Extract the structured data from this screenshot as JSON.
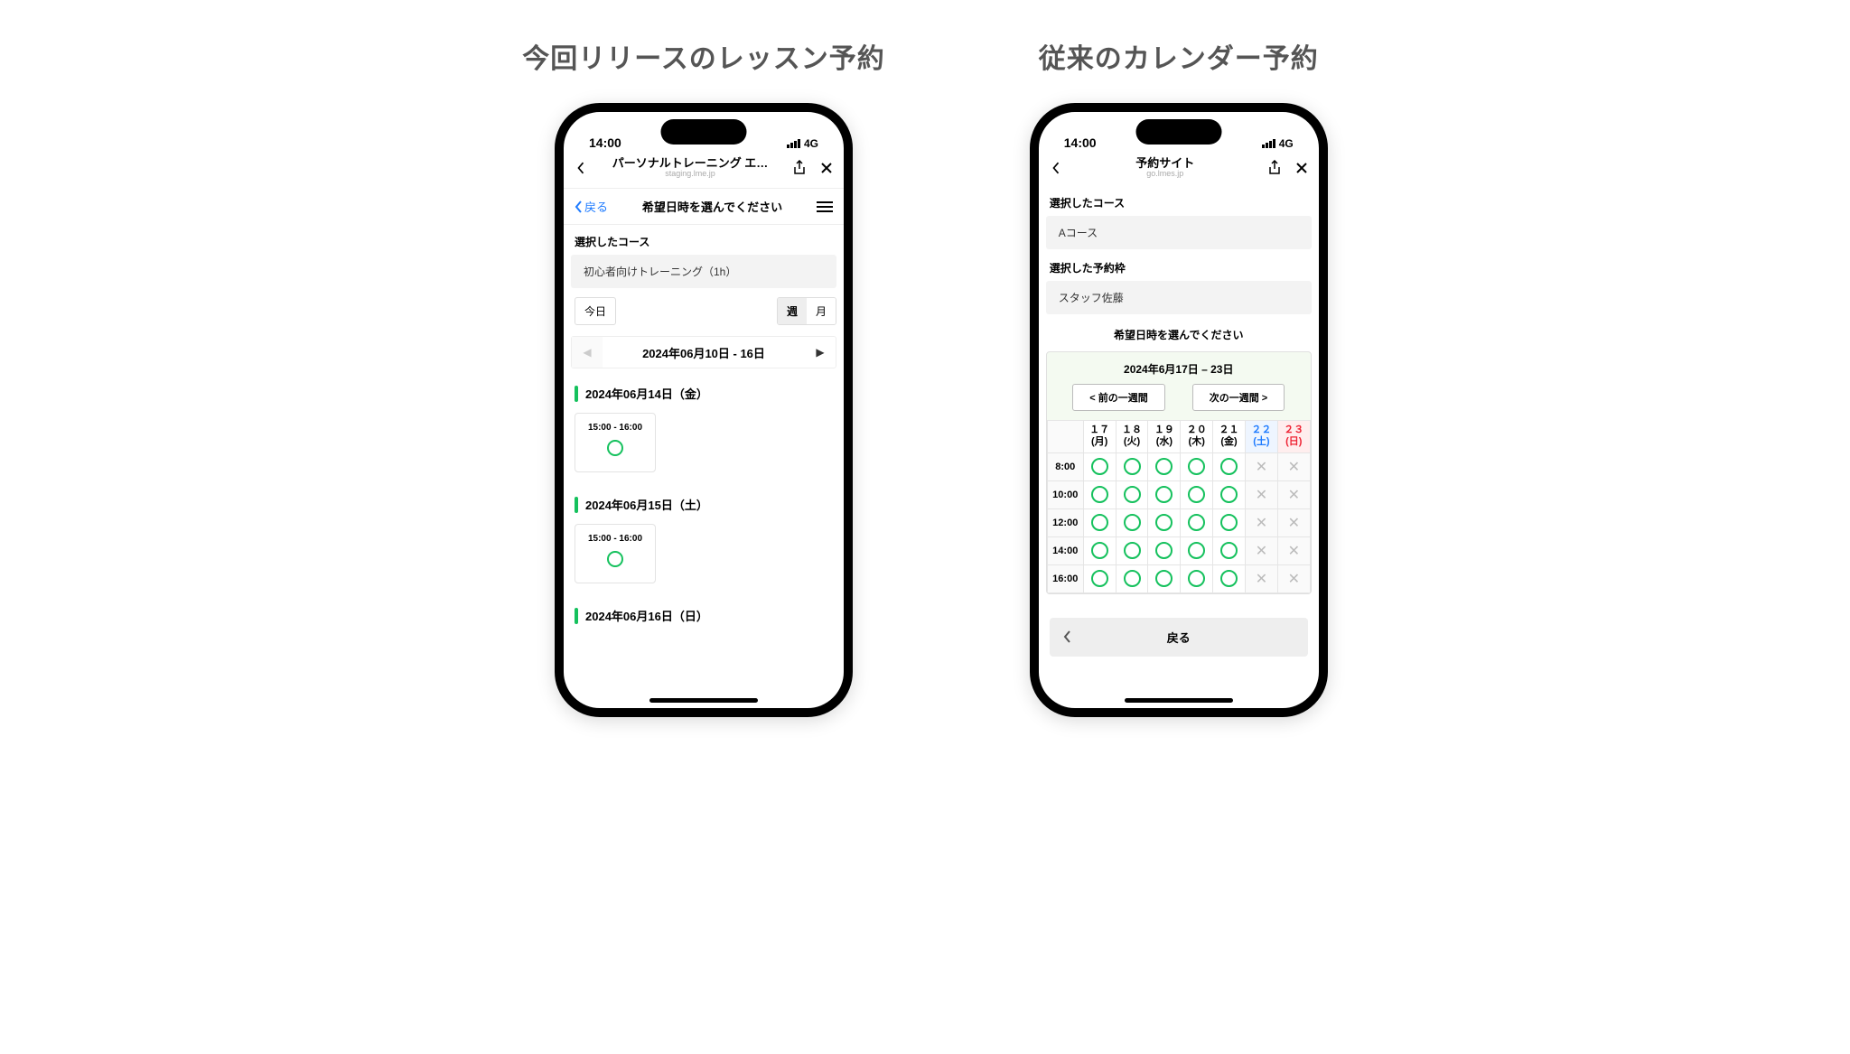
{
  "captions": {
    "left": "今回リリースのレッスン予約",
    "right": "従来のカレンダー予約"
  },
  "status": {
    "time": "14:00",
    "network": "4G"
  },
  "left": {
    "header": {
      "title": "パーソナルトレーニング エ…",
      "domain": "staging.lme.jp"
    },
    "toolbar": {
      "back": "戻る",
      "title": "希望日時を選んでください"
    },
    "section_label": "選択したコース",
    "course": "初心者向けトレーニング（1h）",
    "today": "今日",
    "seg": {
      "week": "週",
      "month": "月"
    },
    "range": "2024年06月10日 - 16日",
    "days": [
      {
        "label": "2024年06月14日（金）",
        "slot": "15:00 - 16:00"
      },
      {
        "label": "2024年06月15日（土）",
        "slot": "15:00 - 16:00"
      },
      {
        "label": "2024年06月16日（日）"
      }
    ]
  },
  "right": {
    "header": {
      "title": "予約サイト",
      "domain": "go.lmes.jp"
    },
    "sec1": "選択したコース",
    "course": "Aコース",
    "sec2": "選択した予約枠",
    "staff": "スタッフ佐藤",
    "prompt": "希望日時を選んでください",
    "range": "2024年6月17日 – 23日",
    "prev": "< 前の一週間",
    "next": "次の一週間 >",
    "day_cols": [
      {
        "num": "１７",
        "dow": "(月)",
        "cls": ""
      },
      {
        "num": "１８",
        "dow": "(火)",
        "cls": ""
      },
      {
        "num": "１９",
        "dow": "(水)",
        "cls": ""
      },
      {
        "num": "２０",
        "dow": "(木)",
        "cls": ""
      },
      {
        "num": "２１",
        "dow": "(金)",
        "cls": ""
      },
      {
        "num": "２２",
        "dow": "(土)",
        "cls": "sat"
      },
      {
        "num": "２３",
        "dow": "(日)",
        "cls": "sun"
      }
    ],
    "rows": [
      {
        "t": "8:00",
        "cells": [
          "o",
          "o",
          "o",
          "o",
          "o",
          "x",
          "x"
        ]
      },
      {
        "t": "10:00",
        "cells": [
          "o",
          "o",
          "o",
          "o",
          "o",
          "x",
          "x"
        ]
      },
      {
        "t": "12:00",
        "cells": [
          "o",
          "o",
          "o",
          "o",
          "o",
          "x",
          "x"
        ]
      },
      {
        "t": "14:00",
        "cells": [
          "o",
          "o",
          "o",
          "o",
          "o",
          "x",
          "x"
        ]
      },
      {
        "t": "16:00",
        "cells": [
          "o",
          "o",
          "o",
          "o",
          "o",
          "x",
          "x"
        ]
      }
    ],
    "back": "戻る"
  }
}
